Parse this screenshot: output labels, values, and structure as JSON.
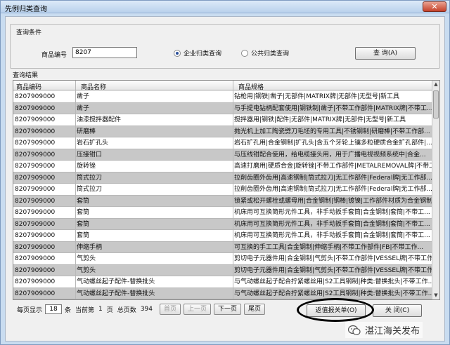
{
  "window": {
    "title": "先例归类查询"
  },
  "query_conditions": {
    "group_label": "查询条件",
    "product_code_label": "商品编号",
    "product_code_value": "8207",
    "radio_enterprise": "企业归类查询",
    "radio_public": "公共归类查询",
    "query_button": "查 询(A)"
  },
  "results": {
    "group_label": "查询结果",
    "columns": [
      "商品编码",
      "商品名称",
      "商品规格"
    ],
    "rows": [
      [
        "8207909000",
        "凿子",
        "钻枪用|钢铁|凿子|无部件|MATRIX牌|无部件|无型号|新工具"
      ],
      [
        "8207909000",
        "凿子",
        "与手提电钻柄配套使用|钢铁制|凿子|不带工作部件|MATRIX牌|不带工..."
      ],
      [
        "8207909000",
        "油漆搅拌器配件",
        "搅拌器用|钢铁|配件|无部件|MATRIX牌|无部件|无型号|新工具"
      ],
      [
        "8207909000",
        "研磨棒",
        "抛光机上加工陶瓷劈刀毛坯的专用工具|不锈钢制|研磨棒|不带工作部..."
      ],
      [
        "8207909000",
        "岩石扩孔头",
        "岩石扩孔用|合金钢制|扩孔头|含五个牙轮上镶多粒硬质合金扩孔部件|..."
      ],
      [
        "8207909000",
        "压接钳口",
        "与压线钳配合使用，给电缆接头用，用于广播电视视频系统中|合金..."
      ],
      [
        "8207909000",
        "旋转锉",
        "高速打磨用|硬质合金|旋转锉|不带工作部件|METALREMOVAL牌|不带工..."
      ],
      [
        "8207909000",
        "筒式拉刀",
        "拉削齿圈外齿用|高速钢制|筒式拉刀|无工作部件|Federal牌|无工作部..."
      ],
      [
        "8207909000",
        "筒式拉刀",
        "拉削齿圈外齿用|高速钢制|筒式拉刀|无工作部件|Federal牌|无工作部..."
      ],
      [
        "8207909000",
        "套筒",
        "锁紧或松开螺栓或螺母用|合金钢制|钢棒|镀镍|工作部件材质为合金钢制|..."
      ],
      [
        "8207909000",
        "套筒",
        "机床用可互换简形元件工具，非手动扳手套筒|合金钢制|套筒|不带工..."
      ],
      [
        "8207909000",
        "套筒",
        "机床用可互换简形元件工具，非手动扳手套筒|合金钢制|套筒|不带工..."
      ],
      [
        "8207909000",
        "套筒",
        "机床用可互换简形元件工具，非手动扳手套筒|合金钢制|套筒|不带工..."
      ],
      [
        "8207909000",
        "伸缩手柄",
        "可互换的手工工具|合金钢制|伸缩手柄|不带工作部件|FB|不带工作..."
      ],
      [
        "8207909000",
        "气剪头",
        "剪切电子元器件用|合金钢制|气剪头|不带工作部件|VESSEL牌|不带工作..."
      ],
      [
        "8207909000",
        "气剪头",
        "剪切电子元器件用|合金钢制|气剪头|不带工作部件|VESSEL牌|不带工作..."
      ],
      [
        "8207909000",
        "气动螺丝起子配件-替换批头",
        "与气动螺丝起子配合拧紧螺丝用|S2工具钢制|种类:替换批头|不带工作..."
      ],
      [
        "8207909000",
        "气动螺丝起子配件-替换批头",
        "与气动螺丝起子配合拧紧螺丝用|S2工具钢制|种类:替换批头|不带工作..."
      ]
    ]
  },
  "pager": {
    "per_page_label": "每页显示",
    "per_page_value": "18",
    "unit_label": "条",
    "current_page_label": "当前第",
    "current_page_value": "1",
    "page_unit_label": "页",
    "total_pages_label": "总页数",
    "total_pages_value": "394",
    "first_page": "首页",
    "prev_page": "上一页",
    "next_page": "下一页",
    "last_page": "尾页"
  },
  "actions": {
    "return_button": "返值报关单(O)",
    "close_button": "关 闭(C)"
  },
  "watermark": {
    "text": "湛江海关发布"
  },
  "colors": {
    "title_bar": "#b9d1ec",
    "close_button": "#c5412a",
    "alt_row": "#c8c8c8"
  }
}
